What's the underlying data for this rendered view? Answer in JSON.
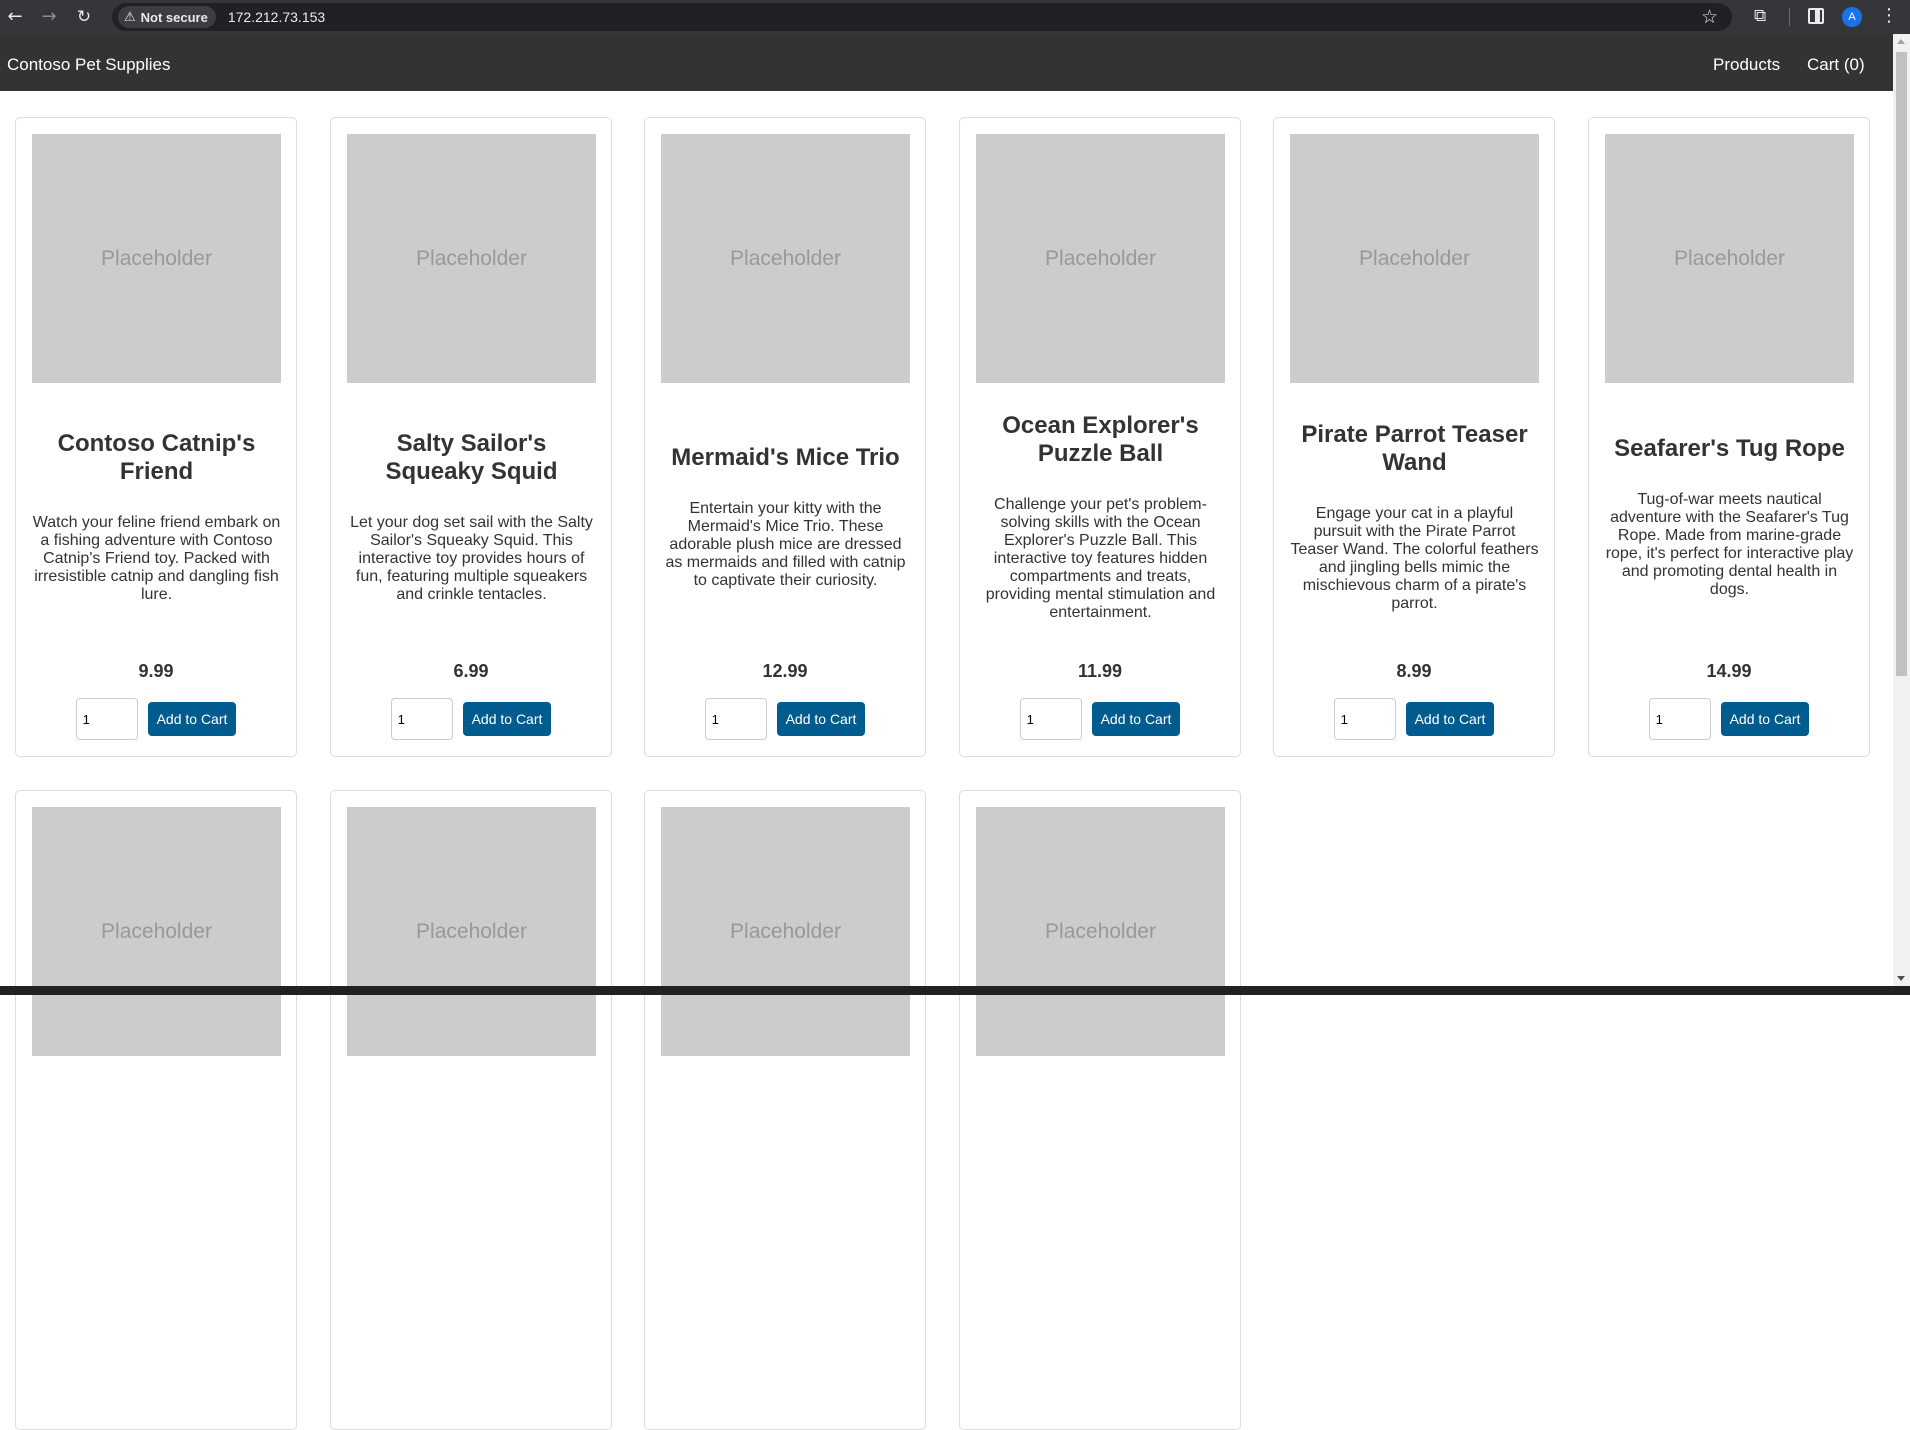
{
  "browser": {
    "security_label": "Not secure",
    "url": "172.212.73.153",
    "profile_initial": "A"
  },
  "site": {
    "brand": "Contoso Pet Supplies",
    "nav": {
      "products": "Products",
      "cart": "Cart (0)"
    }
  },
  "products": [
    {
      "placeholder": "Placeholder",
      "title": "Contoso Catnip's Friend",
      "description": "Watch your feline friend embark on a fishing adventure with Contoso Catnip's Friend toy. Packed with irresistible catnip and dangling fish lure.",
      "price": "9.99",
      "quantity": "1",
      "button": "Add to Cart"
    },
    {
      "placeholder": "Placeholder",
      "title": "Salty Sailor's Squeaky Squid",
      "description": "Let your dog set sail with the Salty Sailor's Squeaky Squid. This interactive toy provides hours of fun, featuring multiple squeakers and crinkle tentacles.",
      "price": "6.99",
      "quantity": "1",
      "button": "Add to Cart"
    },
    {
      "placeholder": "Placeholder",
      "title": "Mermaid's Mice Trio",
      "description": "Entertain your kitty with the Mermaid's Mice Trio. These adorable plush mice are dressed as mermaids and filled with catnip to captivate their curiosity.",
      "price": "12.99",
      "quantity": "1",
      "button": "Add to Cart"
    },
    {
      "placeholder": "Placeholder",
      "title": "Ocean Explorer's Puzzle Ball",
      "description": "Challenge your pet's problem-solving skills with the Ocean Explorer's Puzzle Ball. This interactive toy features hidden compartments and treats, providing mental stimulation and entertainment.",
      "price": "11.99",
      "quantity": "1",
      "button": "Add to Cart"
    },
    {
      "placeholder": "Placeholder",
      "title": "Pirate Parrot Teaser Wand",
      "description": "Engage your cat in a playful pursuit with the Pirate Parrot Teaser Wand. The colorful feathers and jingling bells mimic the mischievous charm of a pirate's parrot.",
      "price": "8.99",
      "quantity": "1",
      "button": "Add to Cart"
    },
    {
      "placeholder": "Placeholder",
      "title": "Seafarer's Tug Rope",
      "description": "Tug-of-war meets nautical adventure with the Seafarer's Tug Rope. Made from marine-grade rope, it's perfect for interactive play and promoting dental health in dogs.",
      "price": "14.99",
      "quantity": "1",
      "button": "Add to Cart"
    },
    {
      "placeholder": "Placeholder"
    },
    {
      "placeholder": "Placeholder"
    },
    {
      "placeholder": "Placeholder"
    },
    {
      "placeholder": "Placeholder"
    }
  ]
}
